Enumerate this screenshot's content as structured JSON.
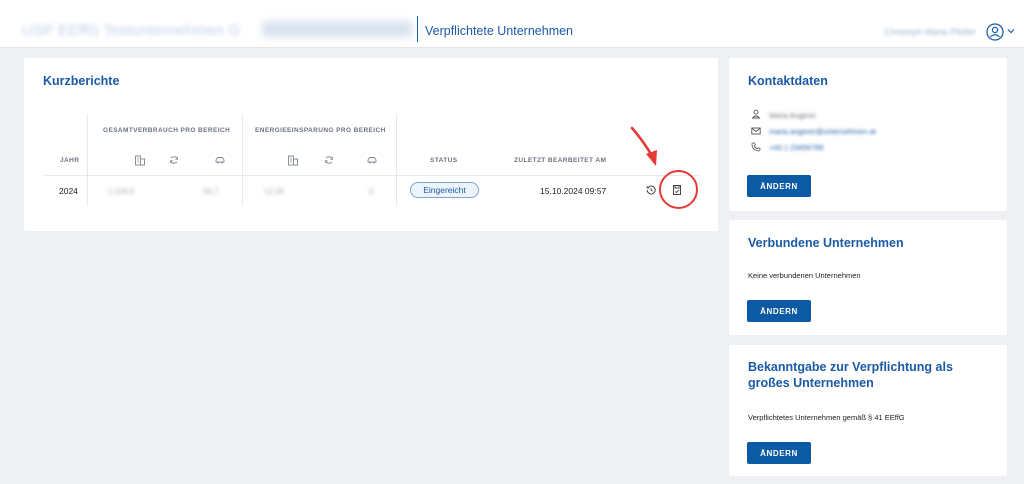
{
  "header": {
    "app_title": "USP EEffG Testunternehmen G",
    "page_title": "Verpflichtete Unternehmen",
    "user_name": "Christoph Maria Pfeifer"
  },
  "kurzberichte": {
    "title": "Kurzberichte",
    "group_headers": {
      "gesamtverbrauch": "GESAMTVERBRAUCH PRO BEREICH",
      "energieeinsparung": "ENERGIEEINSPARUNG PRO BEREICH"
    },
    "column_headers": {
      "jahr": "JAHR",
      "status": "STATUS",
      "zuletzt": "ZULETZT BEARBEITET AM"
    },
    "rows": [
      {
        "jahr": "2024",
        "gv_gebaeude": "1.234,5",
        "gv_prozesse": "",
        "gv_transport": "56,7",
        "ee_gebaeude": "12,34",
        "ee_prozesse": "",
        "ee_transport": "0",
        "status": "Eingereicht",
        "zuletzt": "15.10.2024 09:57"
      }
    ]
  },
  "kontaktdaten": {
    "title": "Kontaktdaten",
    "name": "Maria Angerer",
    "email": "maria.angerer@unternehmen.at",
    "phone": "+43 1 23456789",
    "button": "ÄNDERN"
  },
  "verbundene": {
    "title": "Verbundene Unternehmen",
    "text": "Keine verbundenen Unternehmen",
    "button": "ÄNDERN"
  },
  "bekanntgabe": {
    "title": "Bekanntgabe zur Verpflichtung als großes Unternehmen",
    "text": "Verpflichtetes Unternehmen gemäß § 41 EEffG",
    "button": "ÄNDERN"
  },
  "colors": {
    "brand_blue": "#1a5aa6",
    "button_blue": "#0b5aa3",
    "annotation_red": "#e53935"
  }
}
